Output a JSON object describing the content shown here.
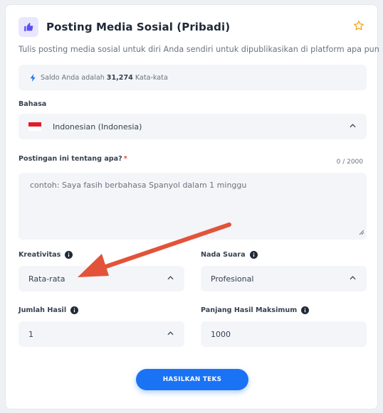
{
  "tool": {
    "title": "Posting Media Sosial (Pribadi)",
    "description": "Tulis posting media sosial untuk diri Anda sendiri untuk dipublikasikan di platform apa pun",
    "icon": "thumbs-up-icon",
    "favorite_icon": "star-icon"
  },
  "balance": {
    "prefix": "Saldo Anda adalah",
    "amount": "31,274",
    "unit": "Kata-kata"
  },
  "language": {
    "label": "Bahasa",
    "value": "Indonesian (Indonesia)"
  },
  "topic": {
    "label": "Postingan ini tentang apa?",
    "required_mark": "*",
    "counter": "0 / 2000",
    "placeholder": "contoh: Saya fasih berbahasa Spanyol dalam 1 minggu"
  },
  "creativity": {
    "label": "Kreativitas",
    "value": "Rata-rata"
  },
  "tone": {
    "label": "Nada Suara",
    "value": "Profesional"
  },
  "result_count": {
    "label": "Jumlah Hasil",
    "value": "1"
  },
  "max_length": {
    "label": "Panjang Hasil Maksimum",
    "value": "1000"
  },
  "generate_button": {
    "label": "HASILKAN TEKS"
  },
  "colors": {
    "accent": "#1a73f5",
    "icon_bg": "#e9e6ff",
    "icon_fg": "#5b4ff5",
    "star": "#f5a623",
    "annotation_arrow": "#e2533a"
  }
}
